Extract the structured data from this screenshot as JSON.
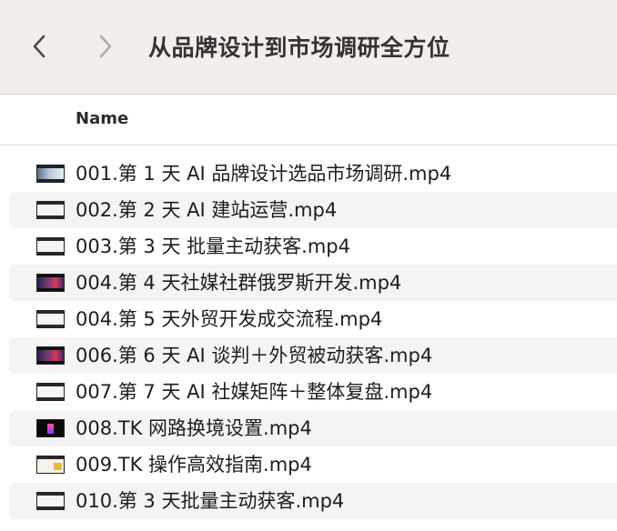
{
  "toolbar": {
    "title": "从品牌设计到市场调研全方位",
    "back_icon": "chevron-left-icon",
    "forward_icon": "chevron-right-icon"
  },
  "columns": {
    "name_label": "Name"
  },
  "files": [
    {
      "name": "001.第 1 天 AI 品牌设计选品市场调研.mp4",
      "thumb": "blue"
    },
    {
      "name": "002.第 2 天 AI 建站运营.mp4",
      "thumb": "light"
    },
    {
      "name": "003.第 3 天  批量主动获客.mp4",
      "thumb": "light"
    },
    {
      "name": "004.第 4 天社媒社群俄罗斯开发.mp4",
      "thumb": "purple"
    },
    {
      "name": "004.第 5 天外贸开发成交流程.mp4",
      "thumb": "light"
    },
    {
      "name": "006.第 6 天 AI 谈判＋外贸被动获客.mp4",
      "thumb": "purple"
    },
    {
      "name": "007.第 7 天 AI 社媒矩阵＋整体复盘.mp4",
      "thumb": "light"
    },
    {
      "name": "008.TK 网路换境设置.mp4",
      "thumb": "dark"
    },
    {
      "name": "009.TK 操作高效指南.mp4",
      "thumb": "gold"
    },
    {
      "name": "010.第 3 天批量主动获客.mp4",
      "thumb": "light"
    }
  ],
  "colors": {
    "toolbar_bg": "#f3eeec",
    "row_alt_bg": "#f4f4f5",
    "text": "#1d1d1f"
  }
}
